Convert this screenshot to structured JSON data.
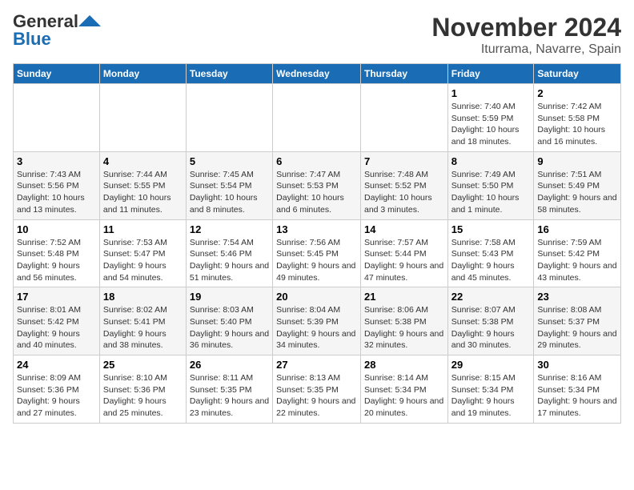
{
  "header": {
    "logo_line1": "General",
    "logo_line2": "Blue",
    "title": "November 2024",
    "subtitle": "Iturrama, Navarre, Spain"
  },
  "days_of_week": [
    "Sunday",
    "Monday",
    "Tuesday",
    "Wednesday",
    "Thursday",
    "Friday",
    "Saturday"
  ],
  "weeks": [
    [
      {
        "day": "",
        "info": ""
      },
      {
        "day": "",
        "info": ""
      },
      {
        "day": "",
        "info": ""
      },
      {
        "day": "",
        "info": ""
      },
      {
        "day": "",
        "info": ""
      },
      {
        "day": "1",
        "info": "Sunrise: 7:40 AM\nSunset: 5:59 PM\nDaylight: 10 hours and 18 minutes."
      },
      {
        "day": "2",
        "info": "Sunrise: 7:42 AM\nSunset: 5:58 PM\nDaylight: 10 hours and 16 minutes."
      }
    ],
    [
      {
        "day": "3",
        "info": "Sunrise: 7:43 AM\nSunset: 5:56 PM\nDaylight: 10 hours and 13 minutes."
      },
      {
        "day": "4",
        "info": "Sunrise: 7:44 AM\nSunset: 5:55 PM\nDaylight: 10 hours and 11 minutes."
      },
      {
        "day": "5",
        "info": "Sunrise: 7:45 AM\nSunset: 5:54 PM\nDaylight: 10 hours and 8 minutes."
      },
      {
        "day": "6",
        "info": "Sunrise: 7:47 AM\nSunset: 5:53 PM\nDaylight: 10 hours and 6 minutes."
      },
      {
        "day": "7",
        "info": "Sunrise: 7:48 AM\nSunset: 5:52 PM\nDaylight: 10 hours and 3 minutes."
      },
      {
        "day": "8",
        "info": "Sunrise: 7:49 AM\nSunset: 5:50 PM\nDaylight: 10 hours and 1 minute."
      },
      {
        "day": "9",
        "info": "Sunrise: 7:51 AM\nSunset: 5:49 PM\nDaylight: 9 hours and 58 minutes."
      }
    ],
    [
      {
        "day": "10",
        "info": "Sunrise: 7:52 AM\nSunset: 5:48 PM\nDaylight: 9 hours and 56 minutes."
      },
      {
        "day": "11",
        "info": "Sunrise: 7:53 AM\nSunset: 5:47 PM\nDaylight: 9 hours and 54 minutes."
      },
      {
        "day": "12",
        "info": "Sunrise: 7:54 AM\nSunset: 5:46 PM\nDaylight: 9 hours and 51 minutes."
      },
      {
        "day": "13",
        "info": "Sunrise: 7:56 AM\nSunset: 5:45 PM\nDaylight: 9 hours and 49 minutes."
      },
      {
        "day": "14",
        "info": "Sunrise: 7:57 AM\nSunset: 5:44 PM\nDaylight: 9 hours and 47 minutes."
      },
      {
        "day": "15",
        "info": "Sunrise: 7:58 AM\nSunset: 5:43 PM\nDaylight: 9 hours and 45 minutes."
      },
      {
        "day": "16",
        "info": "Sunrise: 7:59 AM\nSunset: 5:42 PM\nDaylight: 9 hours and 43 minutes."
      }
    ],
    [
      {
        "day": "17",
        "info": "Sunrise: 8:01 AM\nSunset: 5:42 PM\nDaylight: 9 hours and 40 minutes."
      },
      {
        "day": "18",
        "info": "Sunrise: 8:02 AM\nSunset: 5:41 PM\nDaylight: 9 hours and 38 minutes."
      },
      {
        "day": "19",
        "info": "Sunrise: 8:03 AM\nSunset: 5:40 PM\nDaylight: 9 hours and 36 minutes."
      },
      {
        "day": "20",
        "info": "Sunrise: 8:04 AM\nSunset: 5:39 PM\nDaylight: 9 hours and 34 minutes."
      },
      {
        "day": "21",
        "info": "Sunrise: 8:06 AM\nSunset: 5:38 PM\nDaylight: 9 hours and 32 minutes."
      },
      {
        "day": "22",
        "info": "Sunrise: 8:07 AM\nSunset: 5:38 PM\nDaylight: 9 hours and 30 minutes."
      },
      {
        "day": "23",
        "info": "Sunrise: 8:08 AM\nSunset: 5:37 PM\nDaylight: 9 hours and 29 minutes."
      }
    ],
    [
      {
        "day": "24",
        "info": "Sunrise: 8:09 AM\nSunset: 5:36 PM\nDaylight: 9 hours and 27 minutes."
      },
      {
        "day": "25",
        "info": "Sunrise: 8:10 AM\nSunset: 5:36 PM\nDaylight: 9 hours and 25 minutes."
      },
      {
        "day": "26",
        "info": "Sunrise: 8:11 AM\nSunset: 5:35 PM\nDaylight: 9 hours and 23 minutes."
      },
      {
        "day": "27",
        "info": "Sunrise: 8:13 AM\nSunset: 5:35 PM\nDaylight: 9 hours and 22 minutes."
      },
      {
        "day": "28",
        "info": "Sunrise: 8:14 AM\nSunset: 5:34 PM\nDaylight: 9 hours and 20 minutes."
      },
      {
        "day": "29",
        "info": "Sunrise: 8:15 AM\nSunset: 5:34 PM\nDaylight: 9 hours and 19 minutes."
      },
      {
        "day": "30",
        "info": "Sunrise: 8:16 AM\nSunset: 5:34 PM\nDaylight: 9 hours and 17 minutes."
      }
    ]
  ]
}
